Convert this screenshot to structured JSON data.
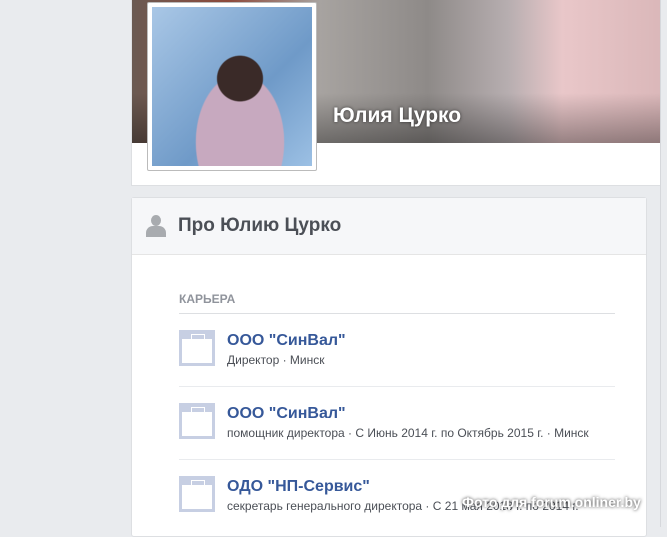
{
  "profile": {
    "name": "Юлия Цурко"
  },
  "about": {
    "title": "Про Юлию Цурко",
    "section_label": "КАРЬЕРА",
    "items": [
      {
        "title": "ООО \"СинВал\"",
        "subtitle": "Директор · Минск"
      },
      {
        "title": "ООО \"СинВал\"",
        "subtitle": "помощник директора · С Июнь 2014 г. по Октябрь 2015 г. · Минск"
      },
      {
        "title": "ОДО \"НП-Сервис\"",
        "subtitle": "секретарь генерального директора · С 21 мая 2013 г. по 2014 г."
      }
    ]
  },
  "watermark": "Фото для forum.onliner.by"
}
